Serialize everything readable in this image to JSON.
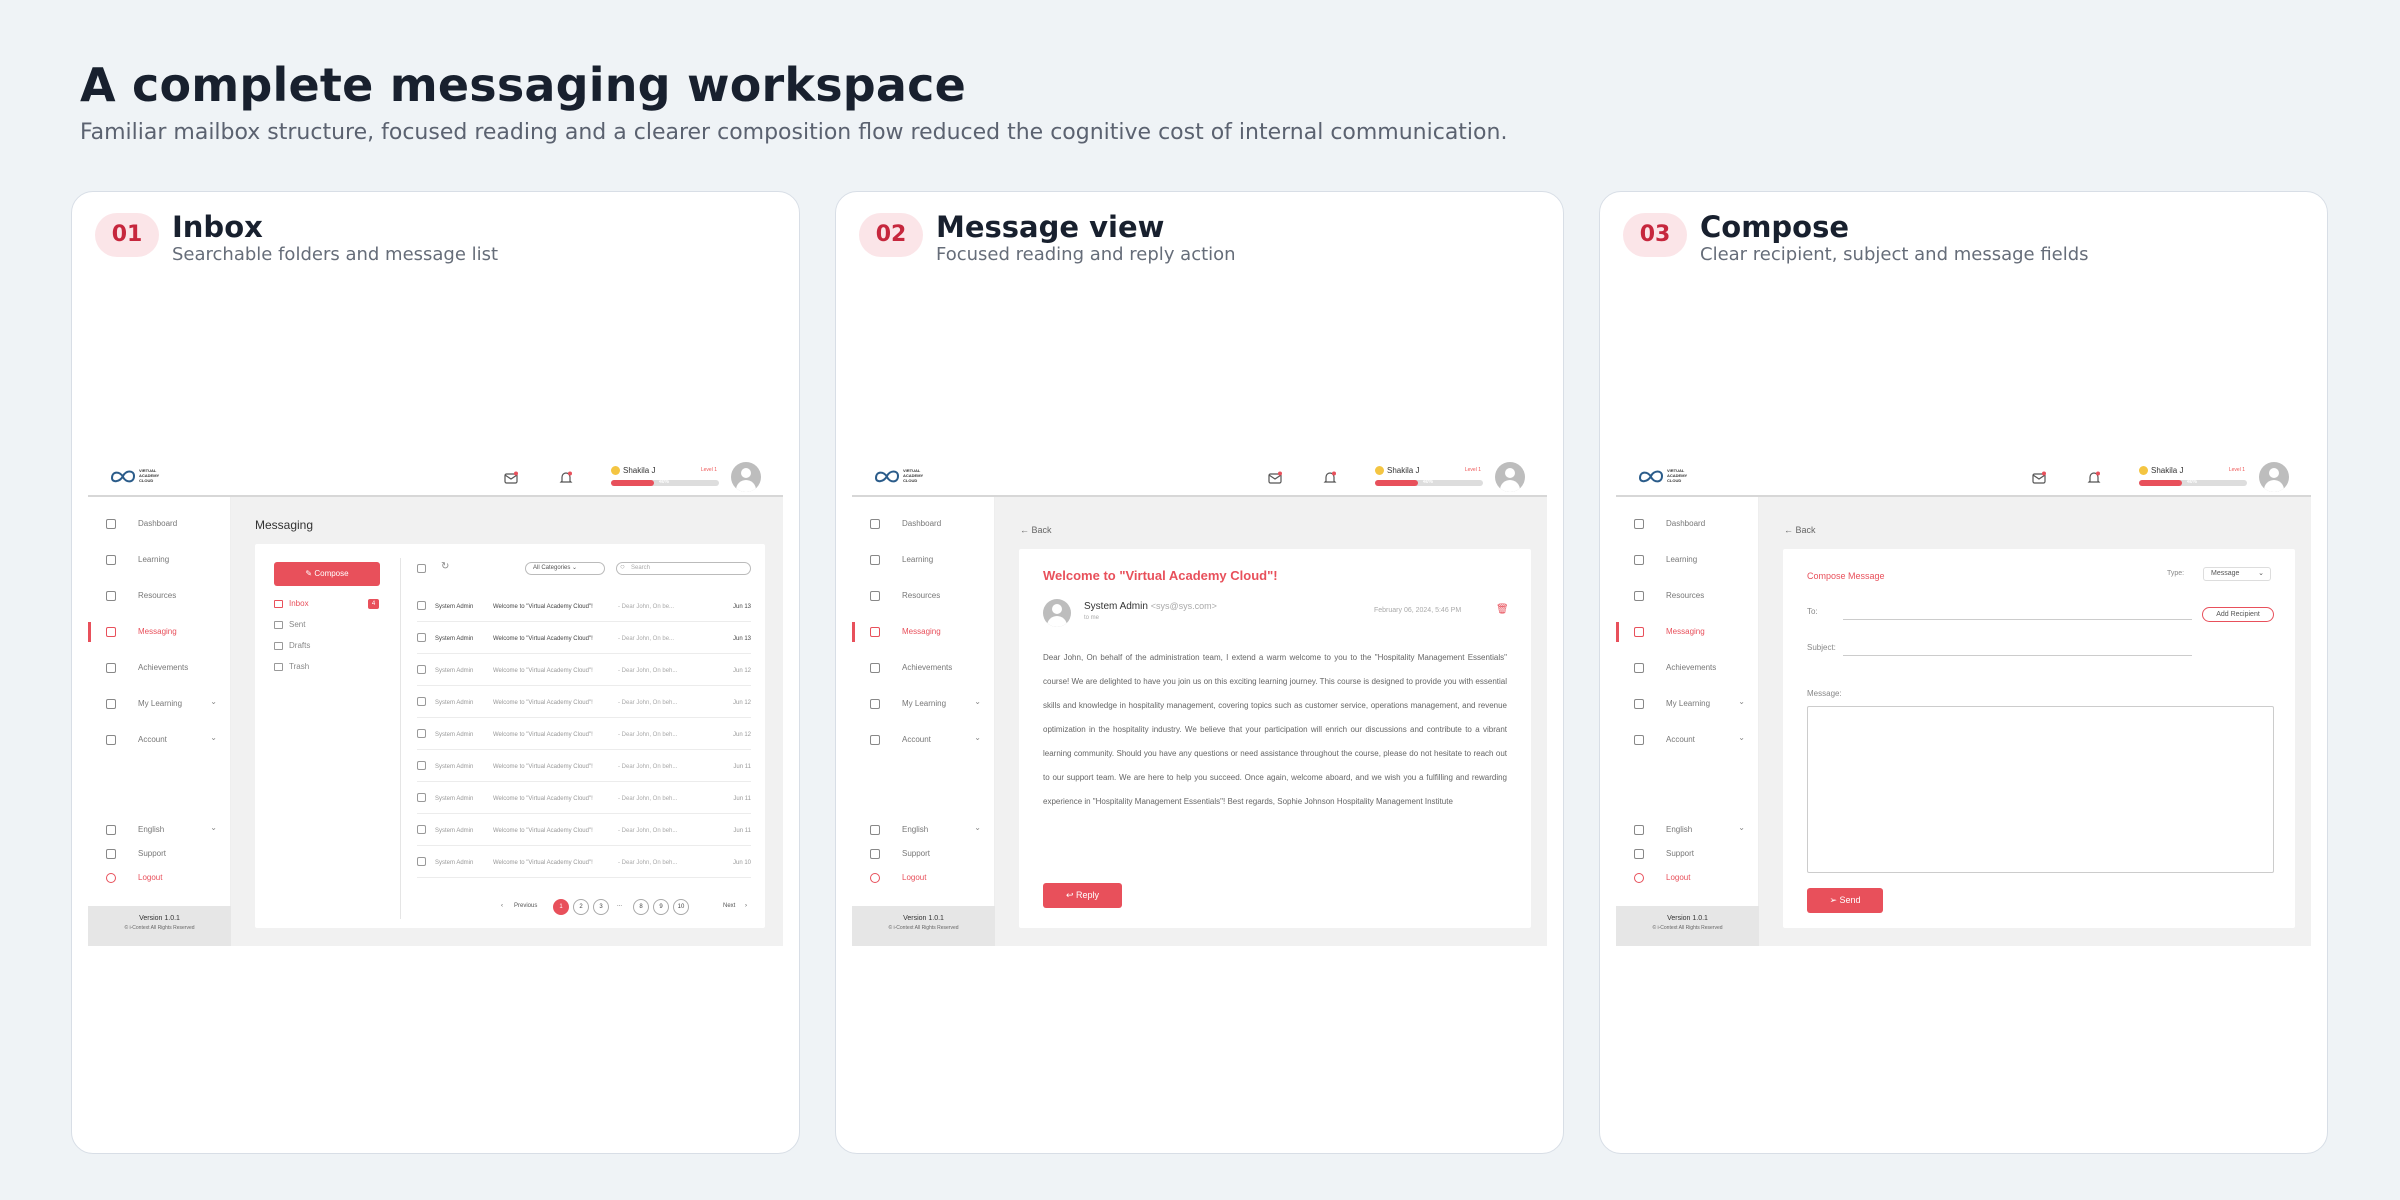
{
  "header": {
    "title": "A complete messaging workspace",
    "subtitle": "Familiar mailbox structure, focused reading and a clearer composition flow reduced the cognitive cost of internal communication."
  },
  "cards": [
    {
      "num": "01",
      "title": "Inbox",
      "subtitle": "Searchable folders and message list"
    },
    {
      "num": "02",
      "title": "Message view",
      "subtitle": "Focused reading and reply action"
    },
    {
      "num": "03",
      "title": "Compose",
      "subtitle": "Clear recipient, subject and message fields"
    }
  ],
  "app": {
    "logo_text": "VIRTUAL ACADEMY CLOUD",
    "user_name": "Shakila J",
    "level": "Level 1",
    "progress_label": "40%",
    "progress": 0.4,
    "nav": [
      "Dashboard",
      "Learning",
      "Resources",
      "Messaging",
      "Achievements",
      "My Learning",
      "Account"
    ],
    "bottom_nav": [
      "English",
      "Support",
      "Logout"
    ],
    "version": "Version 1.0.1",
    "copyright": "© i-Context All Rights Reserved",
    "accent": "#e8505b"
  },
  "inbox": {
    "title": "Messaging",
    "compose": "Compose",
    "folders": [
      "Inbox",
      "Sent",
      "Drafts",
      "Trash"
    ],
    "inbox_count": "4",
    "category": "All Categories",
    "search_placeholder": "Search",
    "rows": [
      {
        "sender": "System Admin",
        "subject": "Welcome to \"Virtual Academy Cloud\"!",
        "preview": "- Dear John, On be...",
        "date": "Jun 13"
      },
      {
        "sender": "System Admin",
        "subject": "Welcome to \"Virtual Academy Cloud\"!",
        "preview": "- Dear John, On be...",
        "date": "Jun 13"
      },
      {
        "sender": "System Admin",
        "subject": "Welcome to \"Virtual Academy Cloud\"!",
        "preview": "- Dear John, On beh...",
        "date": "Jun 12"
      },
      {
        "sender": "System Admin",
        "subject": "Welcome to \"Virtual Academy Cloud\"!",
        "preview": "- Dear John, On beh...",
        "date": "Jun 12"
      },
      {
        "sender": "System Admin",
        "subject": "Welcome to \"Virtual Academy Cloud\"!",
        "preview": "- Dear John, On beh...",
        "date": "Jun 12"
      },
      {
        "sender": "System Admin",
        "subject": "Welcome to \"Virtual Academy Cloud\"!",
        "preview": "- Dear John, On beh...",
        "date": "Jun 11"
      },
      {
        "sender": "System Admin",
        "subject": "Welcome to \"Virtual Academy Cloud\"!",
        "preview": "- Dear John, On beh...",
        "date": "Jun 11"
      },
      {
        "sender": "System Admin",
        "subject": "Welcome to \"Virtual Academy Cloud\"!",
        "preview": "- Dear John, On beh...",
        "date": "Jun 11"
      },
      {
        "sender": "System Admin",
        "subject": "Welcome to \"Virtual Academy Cloud\"!",
        "preview": "- Dear John, On beh...",
        "date": "Jun 10"
      }
    ],
    "pager": {
      "prev": "Previous",
      "next": "Next",
      "pages": [
        "1",
        "2",
        "3",
        "...",
        "8",
        "9",
        "10"
      ]
    }
  },
  "view": {
    "back": "Back",
    "title": "Welcome to \"Virtual Academy Cloud\"!",
    "from": "System Admin",
    "email": "<sys@sys.com>",
    "to": "to me",
    "date": "February 06, 2024, 5:46 PM",
    "body": "Dear John, On behalf of the administration team, I extend a warm welcome to you to the \"Hospitality Management Essentials\" course! We are delighted to have you join us on this exciting learning journey. This course is designed to provide you with essential skills and knowledge in hospitality management, covering topics such as customer service, operations management, and revenue optimization in the hospitality industry. We believe that your participation will enrich our discussions and contribute to a vibrant learning community. Should you have any questions or need assistance throughout the course, please do not hesitate to reach out to our support team. We are here to help you succeed. Once again, welcome aboard, and we wish you a fulfilling and rewarding experience in \"Hospitality Management Essentials\"! Best regards, Sophie Johnson Hospitality Management Institute",
    "reply": "Reply"
  },
  "compose": {
    "back": "Back",
    "title": "Compose Message",
    "type_label": "Type:",
    "type_value": "Message",
    "to": "To:",
    "subject": "Subject:",
    "message": "Message:",
    "add_recipient": "Add Recipient",
    "send": "Send"
  }
}
